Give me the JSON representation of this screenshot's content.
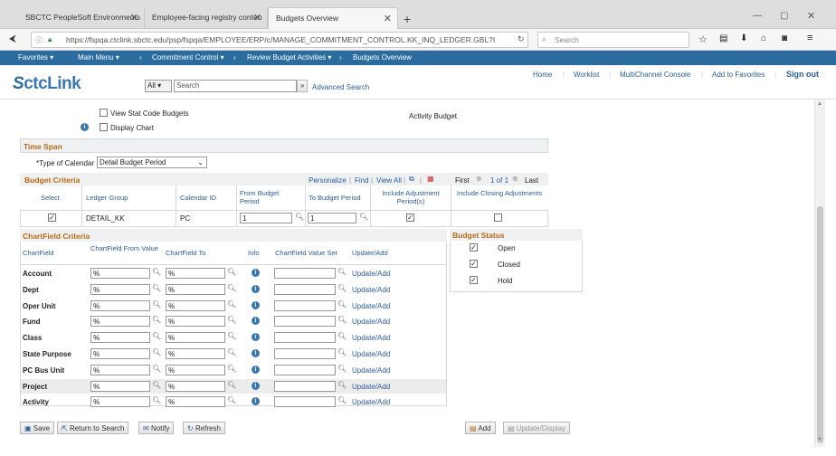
{
  "browser": {
    "tabs": [
      {
        "label": "SBCTC PeopleSoft Environments"
      },
      {
        "label": "Employee-facing registry conten"
      },
      {
        "label": "Budgets Overview"
      }
    ],
    "new_tab": "+",
    "url": "https://fspqa.ctclink.sbctc.edu/psp/fspqa/EMPLOYEE/ERP/c/MANAGE_COMMITMENT_CONTROL.KK_INQ_LEDGER.GBL?I",
    "search_placeholder": "Search"
  },
  "ps_menu": {
    "favorites": "Favorites ▾",
    "main_menu": "Main Menu ▾",
    "crumbs": [
      "Commitment Control ▾",
      "Review Budget Activities ▾",
      "Budgets Overview"
    ]
  },
  "header": {
    "logo": "ctcLink",
    "logo_prefix": "S",
    "search_scope": "All",
    "search_placeholder": "Search",
    "advanced_search": "Advanced Search",
    "links": [
      "Home",
      "Worklist",
      "MultiChannel Console",
      "Add to Favorites",
      "Sign out"
    ]
  },
  "options": {
    "view_stat": "View Stat Code Budgets",
    "display_chart": "Display Chart",
    "activity_budget": "Activity Budget"
  },
  "timespan": {
    "title": "Time Span",
    "type_label": "*Type of Calendar",
    "type_value": "Detail Budget Period"
  },
  "budget_criteria": {
    "title": "Budget Criteria",
    "personalize": "Personalize",
    "find": "Find",
    "view_all": "View All",
    "first": "First",
    "count": "1 of 1",
    "last": "Last",
    "columns": [
      "Select",
      "Ledger Group",
      "Calendar ID",
      "From Budget Period",
      "To Budget Period",
      "Include Adjustment Period(s)",
      "Include Closing Adjustments"
    ],
    "row": {
      "ledger_group": "DETAIL_KK",
      "calendar_id": "PC",
      "from": "1",
      "to": "1"
    }
  },
  "chartfield_criteria": {
    "title": "ChartField Criteria",
    "columns": [
      "ChartField",
      "ChartField From Value",
      "ChartField To",
      "Info",
      "ChartField Value Set",
      "Update/Add"
    ],
    "rows": [
      {
        "name": "Account",
        "from": "%",
        "to": "%",
        "link": "Update/Add"
      },
      {
        "name": "Dept",
        "from": "%",
        "to": "%",
        "link": "Update/Add"
      },
      {
        "name": "Oper Unit",
        "from": "%",
        "to": "%",
        "link": "Update/Add"
      },
      {
        "name": "Fund",
        "from": "%",
        "to": "%",
        "link": "Update/Add"
      },
      {
        "name": "Class",
        "from": "%",
        "to": "%",
        "link": "Update/Add"
      },
      {
        "name": "State Purpose",
        "from": "%",
        "to": "%",
        "link": "Update/Add"
      },
      {
        "name": "PC Bus Unit",
        "from": "%",
        "to": "%",
        "link": "Update/Add"
      },
      {
        "name": "Project",
        "from": "%",
        "to": "%",
        "link": "Update/Add"
      },
      {
        "name": "Activity",
        "from": "%",
        "to": "%",
        "link": "Update/Add"
      }
    ]
  },
  "budget_status": {
    "title": "Budget Status",
    "items": [
      "Open",
      "Closed",
      "Hold"
    ]
  },
  "buttons": {
    "save": "Save",
    "return": "Return to Search",
    "notify": "Notify",
    "refresh": "Refresh",
    "add": "Add",
    "update_display": "Update/Display"
  },
  "colors": {
    "brand": "#2b6c9f",
    "section": "#b86b14",
    "link": "#2a5d97"
  }
}
